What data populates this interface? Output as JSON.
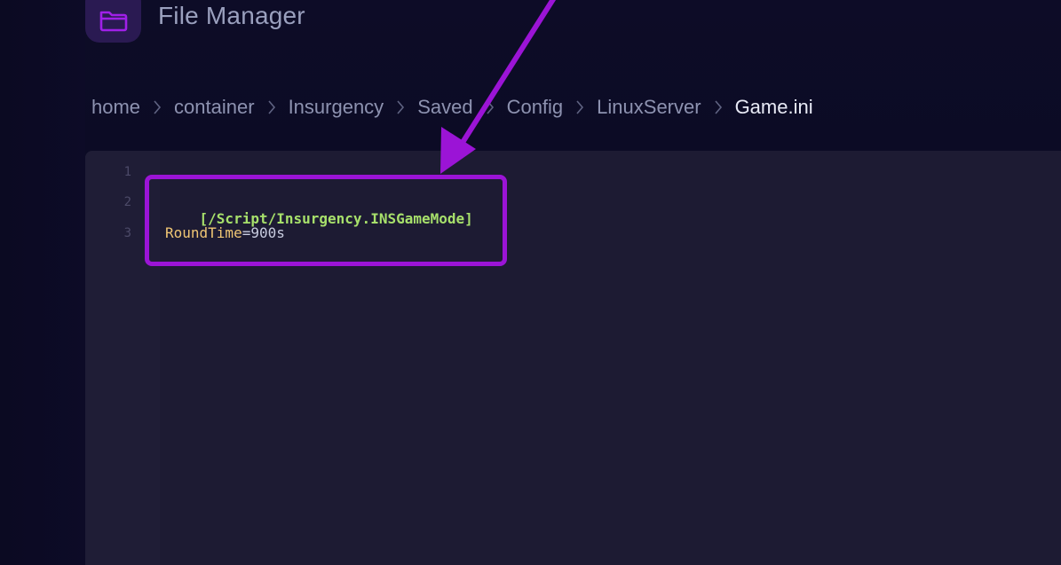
{
  "app": {
    "title": "File Manager",
    "icon": "folder-icon"
  },
  "breadcrumb": {
    "items": [
      "home",
      "container",
      "Insurgency",
      "Saved",
      "Config",
      "LinuxServer"
    ],
    "current": "Game.ini",
    "separator_icon": "chevron-right-icon"
  },
  "editor": {
    "line_numbers": [
      "1",
      "2",
      "3"
    ],
    "lines": {
      "line2_section": "[/Script/Insurgency.INSGameMode]",
      "line3_key": "RoundTime",
      "line3_eq": "=",
      "line3_value": "900s"
    }
  },
  "annotation": {
    "color": "#9b14d6",
    "shape": "arrow-and-box"
  },
  "colors": {
    "background": "#0c0b24",
    "editor_bg": "#1d1b33",
    "section_green": "#a7e06b",
    "key_yellow": "#f0c674",
    "annotation_purple": "#9b14d6"
  }
}
